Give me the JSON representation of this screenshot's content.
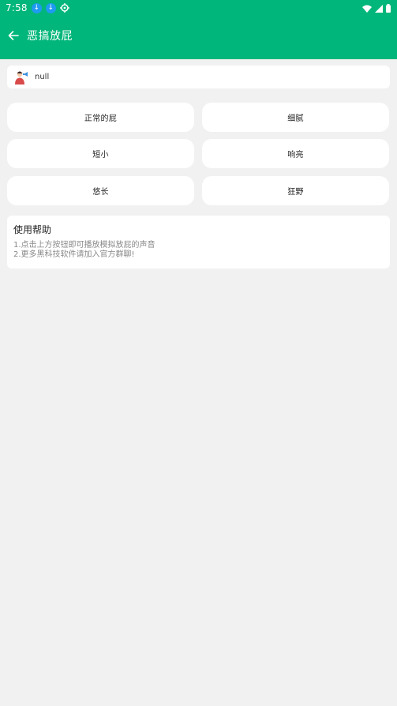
{
  "statusbar": {
    "time": "7:58",
    "notifications": [
      "download-icon",
      "download-icon",
      "settings-gear-icon"
    ],
    "indicators": [
      "wifi-icon",
      "cell-signal-icon",
      "battery-icon"
    ]
  },
  "appbar": {
    "title": "恶搞放屁",
    "color": "#00b67a"
  },
  "info": {
    "avatar_icon": "person-avatar-icon",
    "text": "null"
  },
  "buttons": [
    {
      "label": "正常的屁"
    },
    {
      "label": "细腻"
    },
    {
      "label": "短小"
    },
    {
      "label": "响亮"
    },
    {
      "label": "悠长"
    },
    {
      "label": "狂野"
    }
  ],
  "help": {
    "title": "使用帮助",
    "lines": [
      "1.点击上方按钮即可播放模拟放屁的声音",
      "2.更多黑科技软件请加入官方群聊!"
    ]
  }
}
